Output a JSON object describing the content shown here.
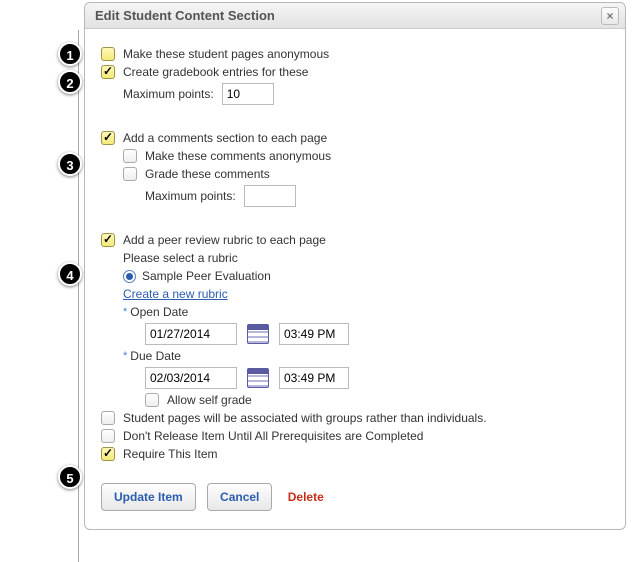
{
  "dialog": {
    "title": "Edit Student Content Section",
    "close_label": "×"
  },
  "badges": [
    "1",
    "2",
    "3",
    "4",
    "5"
  ],
  "opt": {
    "anonymous_pages": {
      "label": "Make these student pages anonymous",
      "checked": false
    },
    "gradebook": {
      "label": "Create gradebook entries for these",
      "checked": true,
      "max_points_label": "Maximum points:",
      "max_points_value": "10"
    },
    "comments": {
      "label": "Add a comments section to each page",
      "checked": true,
      "anon": {
        "label": "Make these comments anonymous",
        "checked": false
      },
      "grade": {
        "label": "Grade these comments",
        "checked": false
      },
      "max_points_label": "Maximum points:",
      "max_points_value": ""
    },
    "peer": {
      "label": "Add a peer review rubric to each page",
      "checked": true,
      "select_rubric_label": "Please select a rubric",
      "rubric_option": "Sample Peer Evaluation",
      "create_link": "Create a new rubric",
      "open_date_label": "Open Date",
      "open_date_value": "01/27/2014",
      "open_time_value": "03:49 PM",
      "due_date_label": "Due Date",
      "due_date_value": "02/03/2014",
      "due_time_value": "03:49 PM",
      "self_grade": {
        "label": "Allow self grade",
        "checked": false
      }
    },
    "groups": {
      "label": "Student pages will be associated with groups rather than individuals.",
      "checked": false
    },
    "prereq": {
      "label": "Don't Release Item Until All Prerequisites are Completed",
      "checked": false
    },
    "require": {
      "label": "Require This Item",
      "checked": true
    }
  },
  "buttons": {
    "update": "Update Item",
    "cancel": "Cancel",
    "delete": "Delete"
  }
}
